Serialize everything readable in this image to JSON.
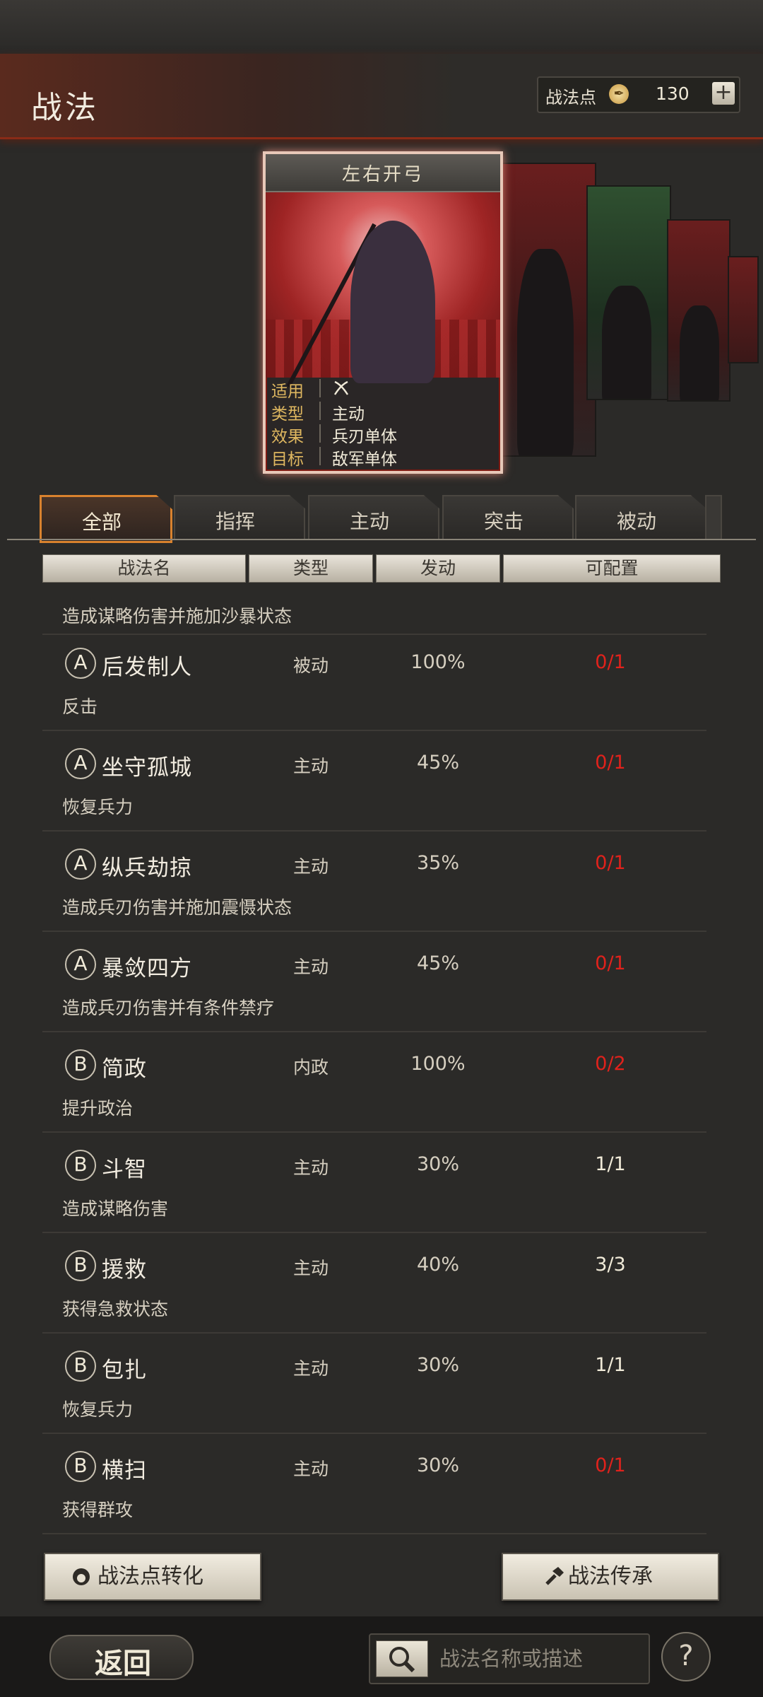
{
  "header": {
    "title": "战法"
  },
  "points": {
    "label": "战法点",
    "value": "130",
    "add": "+"
  },
  "card": {
    "title": "左右开弓",
    "stats": [
      {
        "key": "适用",
        "value": ""
      },
      {
        "key": "类型",
        "value": "主动"
      },
      {
        "key": "效果",
        "value": "兵刃单体"
      },
      {
        "key": "目标",
        "value": "敌军单体"
      }
    ]
  },
  "tabs": [
    "全部",
    "指挥",
    "主动",
    "突击",
    "被动"
  ],
  "columns": [
    "战法名",
    "类型",
    "发动",
    "可配置"
  ],
  "list_top_desc": "造成谋略伤害并施加沙暴状态",
  "skills": [
    {
      "grade": "A",
      "name": "后发制人",
      "type": "被动",
      "rate": "100%",
      "config": "0/1",
      "desc": "反击",
      "full": false
    },
    {
      "grade": "A",
      "name": "坐守孤城",
      "type": "主动",
      "rate": "45%",
      "config": "0/1",
      "desc": "恢复兵力",
      "full": false
    },
    {
      "grade": "A",
      "name": "纵兵劫掠",
      "type": "主动",
      "rate": "35%",
      "config": "0/1",
      "desc": "造成兵刃伤害并施加震慑状态",
      "full": false
    },
    {
      "grade": "A",
      "name": "暴敛四方",
      "type": "主动",
      "rate": "45%",
      "config": "0/1",
      "desc": "造成兵刃伤害并有条件禁疗",
      "full": false
    },
    {
      "grade": "B",
      "name": "简政",
      "type": "内政",
      "rate": "100%",
      "config": "0/2",
      "desc": "提升政治",
      "full": false
    },
    {
      "grade": "B",
      "name": "斗智",
      "type": "主动",
      "rate": "30%",
      "config": "1/1",
      "desc": "造成谋略伤害",
      "full": true
    },
    {
      "grade": "B",
      "name": "援救",
      "type": "主动",
      "rate": "40%",
      "config": "3/3",
      "desc": "获得急救状态",
      "full": true
    },
    {
      "grade": "B",
      "name": "包扎",
      "type": "主动",
      "rate": "30%",
      "config": "1/1",
      "desc": "恢复兵力",
      "full": true
    },
    {
      "grade": "B",
      "name": "横扫",
      "type": "主动",
      "rate": "30%",
      "config": "0/1",
      "desc": "获得群攻",
      "full": false
    }
  ],
  "buttons": {
    "convert": "战法点转化",
    "inherit": "战法传承",
    "back": "返回",
    "help": "?"
  },
  "search": {
    "placeholder": "战法名称或描述"
  },
  "colors": {
    "config_empty": "#e0221c",
    "config_full": "#f0ead8",
    "tab_active_border": "#d9822e"
  }
}
